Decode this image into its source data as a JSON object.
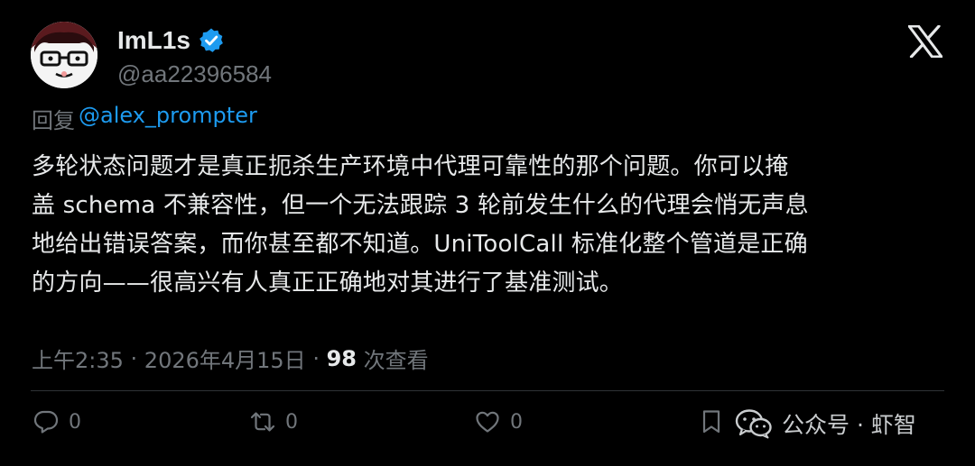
{
  "author": {
    "display_name": "ImL1s",
    "handle": "@aa22396584",
    "verified_icon": "verified-badge-icon",
    "verified_color": "#1d9bf0"
  },
  "reply": {
    "prefix": "回复",
    "mention": "@alex_prompter"
  },
  "tweet": {
    "lines": [
      "多轮状态问题才是真正扼杀生产环境中代理可靠性的那个问题。你可以掩",
      "盖 schema 不兼容性，但一个无法跟踪 3 轮前发生什么的代理会悄无声息",
      "地给出错误答案，而你甚至都不知道。UniToolCall 标准化整个管道是正确",
      "的方向——很高兴有人真正正确地对其进行了基准测试。"
    ]
  },
  "meta": {
    "time": "上午2:35",
    "sep1": " · ",
    "date": "2026年4月15日",
    "sep2": " · ",
    "views_count": "98",
    "views_label": " 次查看"
  },
  "actions": {
    "reply_count": "0",
    "retweet_count": "0",
    "like_count": "0"
  },
  "watermark": {
    "text": "公众号 · 虾智"
  },
  "colors": {
    "background": "#000000",
    "text": "#e7e9ea",
    "secondary": "#71767b",
    "accent": "#1d9bf0"
  }
}
